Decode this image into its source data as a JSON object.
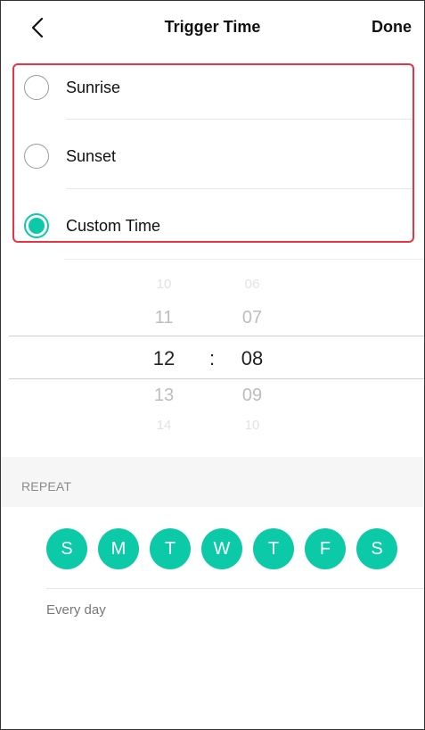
{
  "header": {
    "title": "Trigger Time",
    "done_label": "Done"
  },
  "options": [
    {
      "label": "Sunrise",
      "selected": false
    },
    {
      "label": "Sunset",
      "selected": false
    },
    {
      "label": "Custom Time",
      "selected": true
    }
  ],
  "picker": {
    "hours": [
      "10",
      "11",
      "12",
      "13",
      "14"
    ],
    "minutes": [
      "06",
      "07",
      "08",
      "09",
      "10"
    ],
    "selected_hour": "12",
    "selected_minute": "08",
    "separator": ":"
  },
  "repeat": {
    "label": "REPEAT",
    "days": [
      "S",
      "M",
      "T",
      "W",
      "T",
      "F",
      "S"
    ],
    "summary": "Every day"
  },
  "colors": {
    "accent": "#0cc9a8",
    "highlight_border": "#e53545"
  }
}
